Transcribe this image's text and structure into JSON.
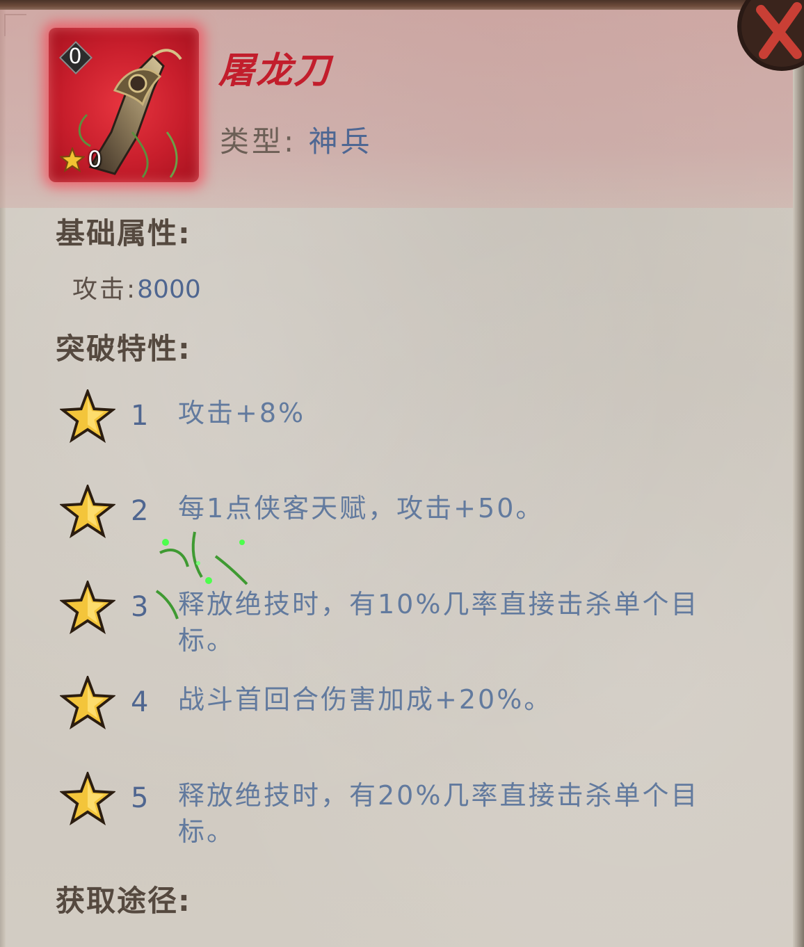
{
  "item": {
    "level": "0",
    "stars": "0",
    "name": "屠龙刀",
    "type_label": "类型:",
    "type_value": "神兵",
    "rarity_color": "#c81e2c"
  },
  "base_attributes": {
    "heading": "基础属性:",
    "attack_label": "攻击:",
    "attack_value": "8000"
  },
  "breakthrough": {
    "heading": "突破特性:",
    "traits": [
      {
        "num": "1",
        "desc": "攻击+8%"
      },
      {
        "num": "2",
        "desc": "每1点侠客天赋，攻击+50。"
      },
      {
        "num": "3",
        "desc": "释放绝技时，有10%几率直接击杀单个目标。"
      },
      {
        "num": "4",
        "desc": "战斗首回合伤害加成+20%。"
      },
      {
        "num": "5",
        "desc": "释放绝技时，有20%几率直接击杀单个目标。"
      }
    ]
  },
  "source": {
    "heading": "获取途径:"
  },
  "icons": {
    "close": "close-x-icon",
    "star": "gold-star-icon",
    "weapon": "dragon-saber-icon"
  },
  "colors": {
    "name": "#c21e2c",
    "value_blue": "#4f6690",
    "trait_text": "#627a9e",
    "heading": "#55493f"
  }
}
